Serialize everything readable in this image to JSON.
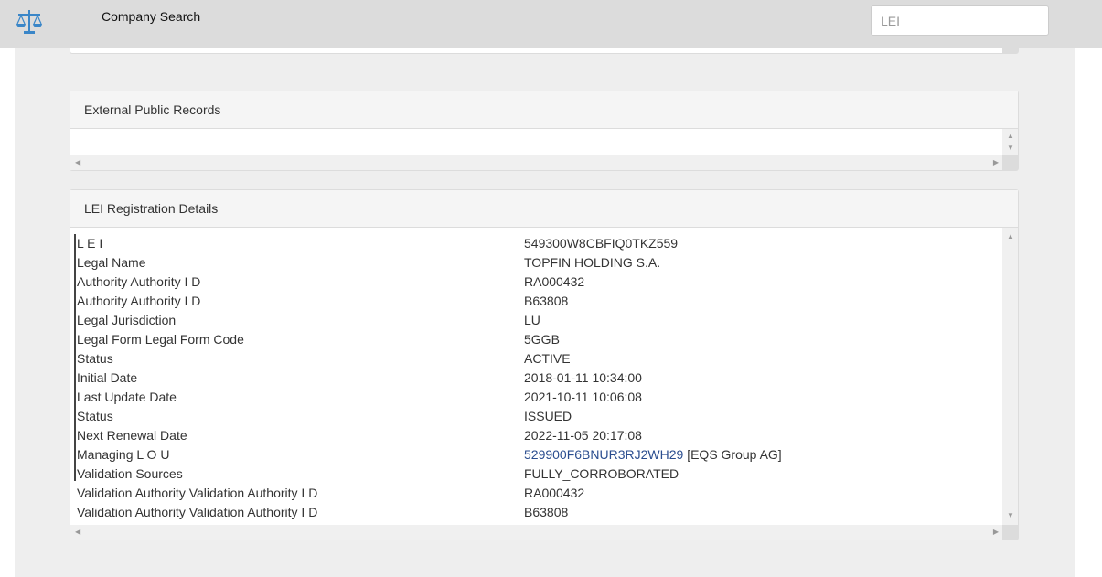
{
  "header": {
    "app_title": "Company Search",
    "search_placeholder": "LEI",
    "logo_icon": "scales-icon",
    "accent_color": "#3a86c8"
  },
  "panels": {
    "external_records": {
      "title": "External Public Records"
    },
    "lei_details": {
      "title": "LEI Registration Details",
      "rows": [
        {
          "label": "L E I",
          "value": "549300W8CBFIQ0TKZ559"
        },
        {
          "label": "Legal Name",
          "value": "TOPFIN HOLDING S.A."
        },
        {
          "label": "Authority Authority I D",
          "value": "RA000432"
        },
        {
          "label": "Authority Authority I D",
          "value": "B63808"
        },
        {
          "label": "Legal Jurisdiction",
          "value": "LU"
        },
        {
          "label": "Legal Form Legal Form Code",
          "value": "5GGB"
        },
        {
          "label": "Status",
          "value": "ACTIVE"
        },
        {
          "label": "Initial Date",
          "value": "2018-01-11 10:34:00"
        },
        {
          "label": "Last Update Date",
          "value": "2021-10-11 10:06:08"
        },
        {
          "label": "Status",
          "value": "ISSUED"
        },
        {
          "label": "Next Renewal Date",
          "value": "2022-11-05 20:17:08"
        },
        {
          "label": "Managing L O U",
          "value_link": "529900F6BNUR3RJ2WH29",
          "value_suffix": " [EQS Group AG]"
        },
        {
          "label": "Validation Sources",
          "value": "FULLY_CORROBORATED"
        },
        {
          "label": "Validation Authority Validation Authority I D",
          "value": "RA000432"
        },
        {
          "label": "Validation Authority Validation Authority I D",
          "value": "B63808"
        }
      ]
    }
  }
}
